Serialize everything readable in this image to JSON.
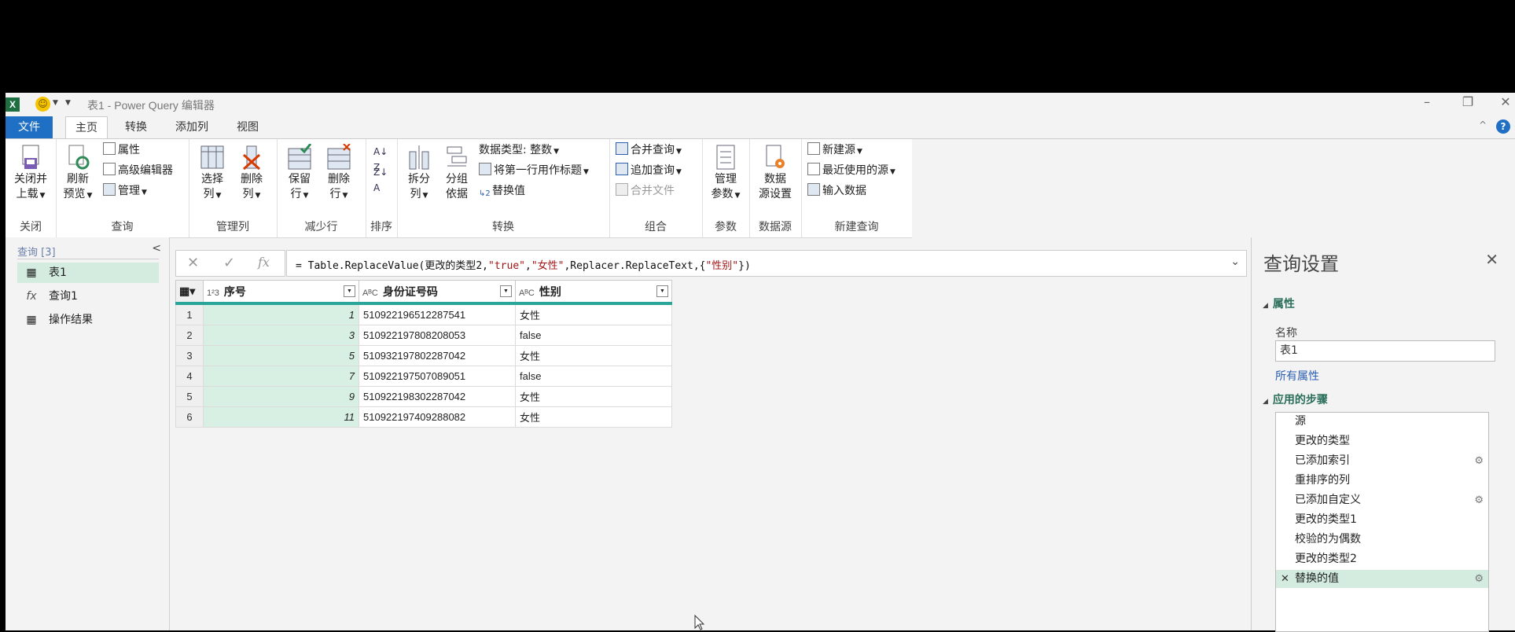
{
  "title": {
    "window_title": "表1 - Power Query 编辑器"
  },
  "tabs": [
    {
      "label": "文件"
    },
    {
      "label": "主页"
    },
    {
      "label": "转换"
    },
    {
      "label": "添加列"
    },
    {
      "label": "视图"
    }
  ],
  "ribbon": {
    "close": {
      "label1": "关闭并",
      "label2": "上载",
      "group": "关闭"
    },
    "query": {
      "refresh1": "刷新",
      "refresh2": "预览",
      "properties": "属性",
      "advanced_editor": "高级编辑器",
      "manage": "管理",
      "group": "查询"
    },
    "manage_columns": {
      "choose1": "选择",
      "choose2": "列",
      "remove1": "删除",
      "remove2": "列",
      "group": "管理列"
    },
    "reduce_rows": {
      "keep1": "保留",
      "keep2": "行",
      "remove1": "删除",
      "remove2": "行",
      "group": "减少行"
    },
    "sort": {
      "group": "排序"
    },
    "transform": {
      "split1": "拆分",
      "split2": "列",
      "group_by1": "分组",
      "group_by2": "依据",
      "data_type": "数据类型: 整数",
      "first_row_headers": "将第一行用作标题",
      "replace_values": "替换值",
      "group": "转换"
    },
    "combine": {
      "merge": "合并查询",
      "append": "追加查询",
      "combine_files": "合并文件",
      "group": "组合"
    },
    "params": {
      "manage1": "管理",
      "manage2": "参数",
      "group": "参数"
    },
    "datasource": {
      "settings1": "数据",
      "settings2": "源设置",
      "group": "数据源"
    },
    "new_query": {
      "new_source": "新建源",
      "recent_sources": "最近使用的源",
      "enter_data": "输入数据",
      "group": "新建查询"
    }
  },
  "queries_pane": {
    "header": "查询 [3]",
    "items": [
      {
        "label": "表1",
        "icon": "table-icon"
      },
      {
        "label": "查询1",
        "icon": "function-icon"
      },
      {
        "label": "操作结果",
        "icon": "table-icon"
      }
    ]
  },
  "formula_bar": {
    "part1": "= Table.ReplaceValue(更改的类型2,",
    "s1": "\"true\"",
    "c1": ",",
    "s2": "\"女性\"",
    "part2": ",Replacer.ReplaceText,{",
    "s3": "\"性别\"",
    "part3": "})"
  },
  "table": {
    "columns": [
      {
        "type": "1²3",
        "name": "序号"
      },
      {
        "type": "AᴮC",
        "name": "身份证号码"
      },
      {
        "type": "AᴮC",
        "name": "性别"
      }
    ],
    "rows": [
      {
        "n": "1",
        "id": "1",
        "idcard": "510922196512287541",
        "gender": "女性"
      },
      {
        "n": "2",
        "id": "3",
        "idcard": "510922197808208053",
        "gender": "false"
      },
      {
        "n": "3",
        "id": "5",
        "idcard": "510932197802287042",
        "gender": "女性"
      },
      {
        "n": "4",
        "id": "7",
        "idcard": "510922197507089051",
        "gender": "false"
      },
      {
        "n": "5",
        "id": "9",
        "idcard": "510922198302287042",
        "gender": "女性"
      },
      {
        "n": "6",
        "id": "11",
        "idcard": "510922197409288082",
        "gender": "女性"
      }
    ]
  },
  "settings": {
    "title": "查询设置",
    "properties_header": "属性",
    "name_label": "名称",
    "name_value": "表1",
    "all_properties": "所有属性",
    "steps_header": "应用的步骤",
    "steps": [
      {
        "label": "源"
      },
      {
        "label": "更改的类型"
      },
      {
        "label": "已添加索引"
      },
      {
        "label": "重排序的列"
      },
      {
        "label": "已添加自定义"
      },
      {
        "label": "更改的类型1"
      },
      {
        "label": "校验的为偶数"
      },
      {
        "label": "更改的类型2"
      },
      {
        "label": "替换的值"
      }
    ]
  },
  "colors": {
    "accent_green": "#2aa59a",
    "selection": "#d3ecdf",
    "file_tab": "#1f6fc5",
    "string_literal": "#a31515"
  }
}
